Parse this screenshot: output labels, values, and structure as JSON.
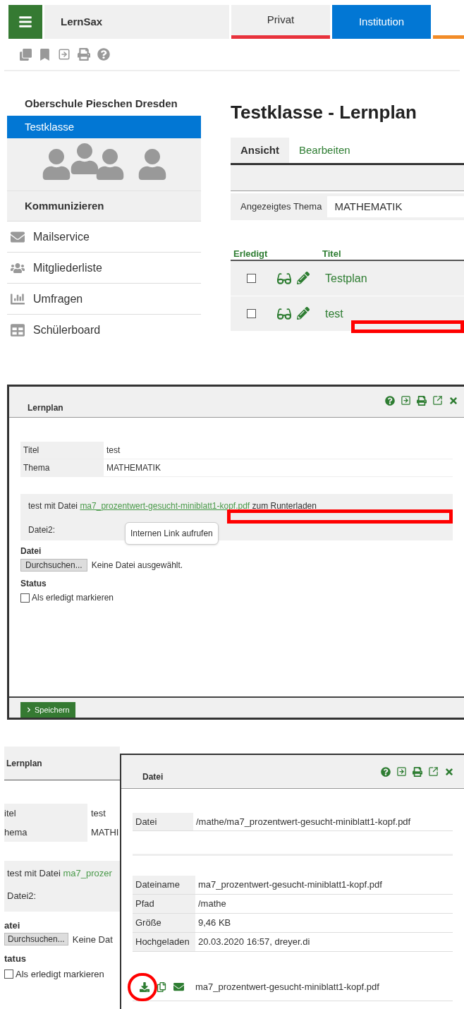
{
  "top": {
    "brand": "LernSax",
    "tabs": [
      {
        "label": "Privat",
        "selected": false,
        "color": "#e8323c"
      },
      {
        "label": "Institution",
        "selected": true,
        "color": "#0277d4"
      }
    ]
  },
  "sidebar": {
    "school": "Oberschule Pieschen Dresden",
    "groups": [
      {
        "label": "Testklasse",
        "selected": true
      }
    ],
    "section": "Kommunizieren",
    "items": [
      {
        "label": "Mailservice",
        "kind": "mail"
      },
      {
        "label": "Mitgliederliste",
        "kind": "members"
      },
      {
        "label": "Umfragen",
        "kind": "poll"
      },
      {
        "label": "Schülerboard",
        "kind": "board"
      }
    ]
  },
  "main": {
    "title": "Testklasse - Lernplan",
    "tabs": [
      {
        "label": "Ansicht",
        "selected": true
      },
      {
        "label": "Bearbeiten",
        "selected": false
      }
    ],
    "filter": {
      "label": "Angezeigtes Thema",
      "value": "MATHEMATIK"
    },
    "columns": [
      "Erledigt",
      "Titel"
    ],
    "rows": [
      {
        "checked": false,
        "title": "Testplan"
      },
      {
        "checked": false,
        "title": "test"
      }
    ]
  },
  "lernplan_dialog": {
    "title": "Lernplan",
    "fields": [
      {
        "label": "Titel",
        "value": "test"
      },
      {
        "label": "Thema",
        "value": "MATHEMATIK"
      }
    ],
    "description": {
      "before": "test mit Datei",
      "link": "ma7_prozentwert-gesucht-miniblatt1-kopf.pdf",
      "after": "zum Runterladen"
    },
    "file2_label": "Datei2:",
    "tooltip": "Internen Link aufrufen",
    "file_label": "Datei",
    "browse": "Durchsuchen...",
    "no_file": "Keine Datei ausgewählt.",
    "status_label": "Status",
    "done": {
      "label": "Als erledigt markieren",
      "checked": false
    },
    "save": "Speichern"
  },
  "background_dialog": {
    "title": "Lernplan",
    "fields": [
      {
        "label": "itel",
        "value": "test"
      },
      {
        "label": "hema",
        "value": "MATHI"
      }
    ],
    "description": {
      "before": "test mit Datei",
      "link": "ma7_prozer"
    },
    "file2_label": "Datei2:",
    "file_label": "atei",
    "browse": "Durchsuchen...",
    "no_file": "Keine Dat",
    "status_label": "tatus",
    "done": {
      "label": "Als erledigt markieren",
      "checked": false
    }
  },
  "datei_dialog": {
    "title": "Datei",
    "path": {
      "label": "Datei",
      "value": "/mathe/ma7_prozentwert-gesucht-miniblatt1-kopf.pdf"
    },
    "details": [
      {
        "label": "Dateiname",
        "value": "ma7_prozentwert-gesucht-miniblatt1-kopf.pdf"
      },
      {
        "label": "Pfad",
        "value": "/mathe"
      },
      {
        "label": "Größe",
        "value": "9,46 KB"
      },
      {
        "label": "Hochgeladen",
        "value": "20.03.2020 16:57, dreyer.di"
      }
    ],
    "file": "ma7_prozentwert-gesucht-miniblatt1-kopf.pdf"
  }
}
